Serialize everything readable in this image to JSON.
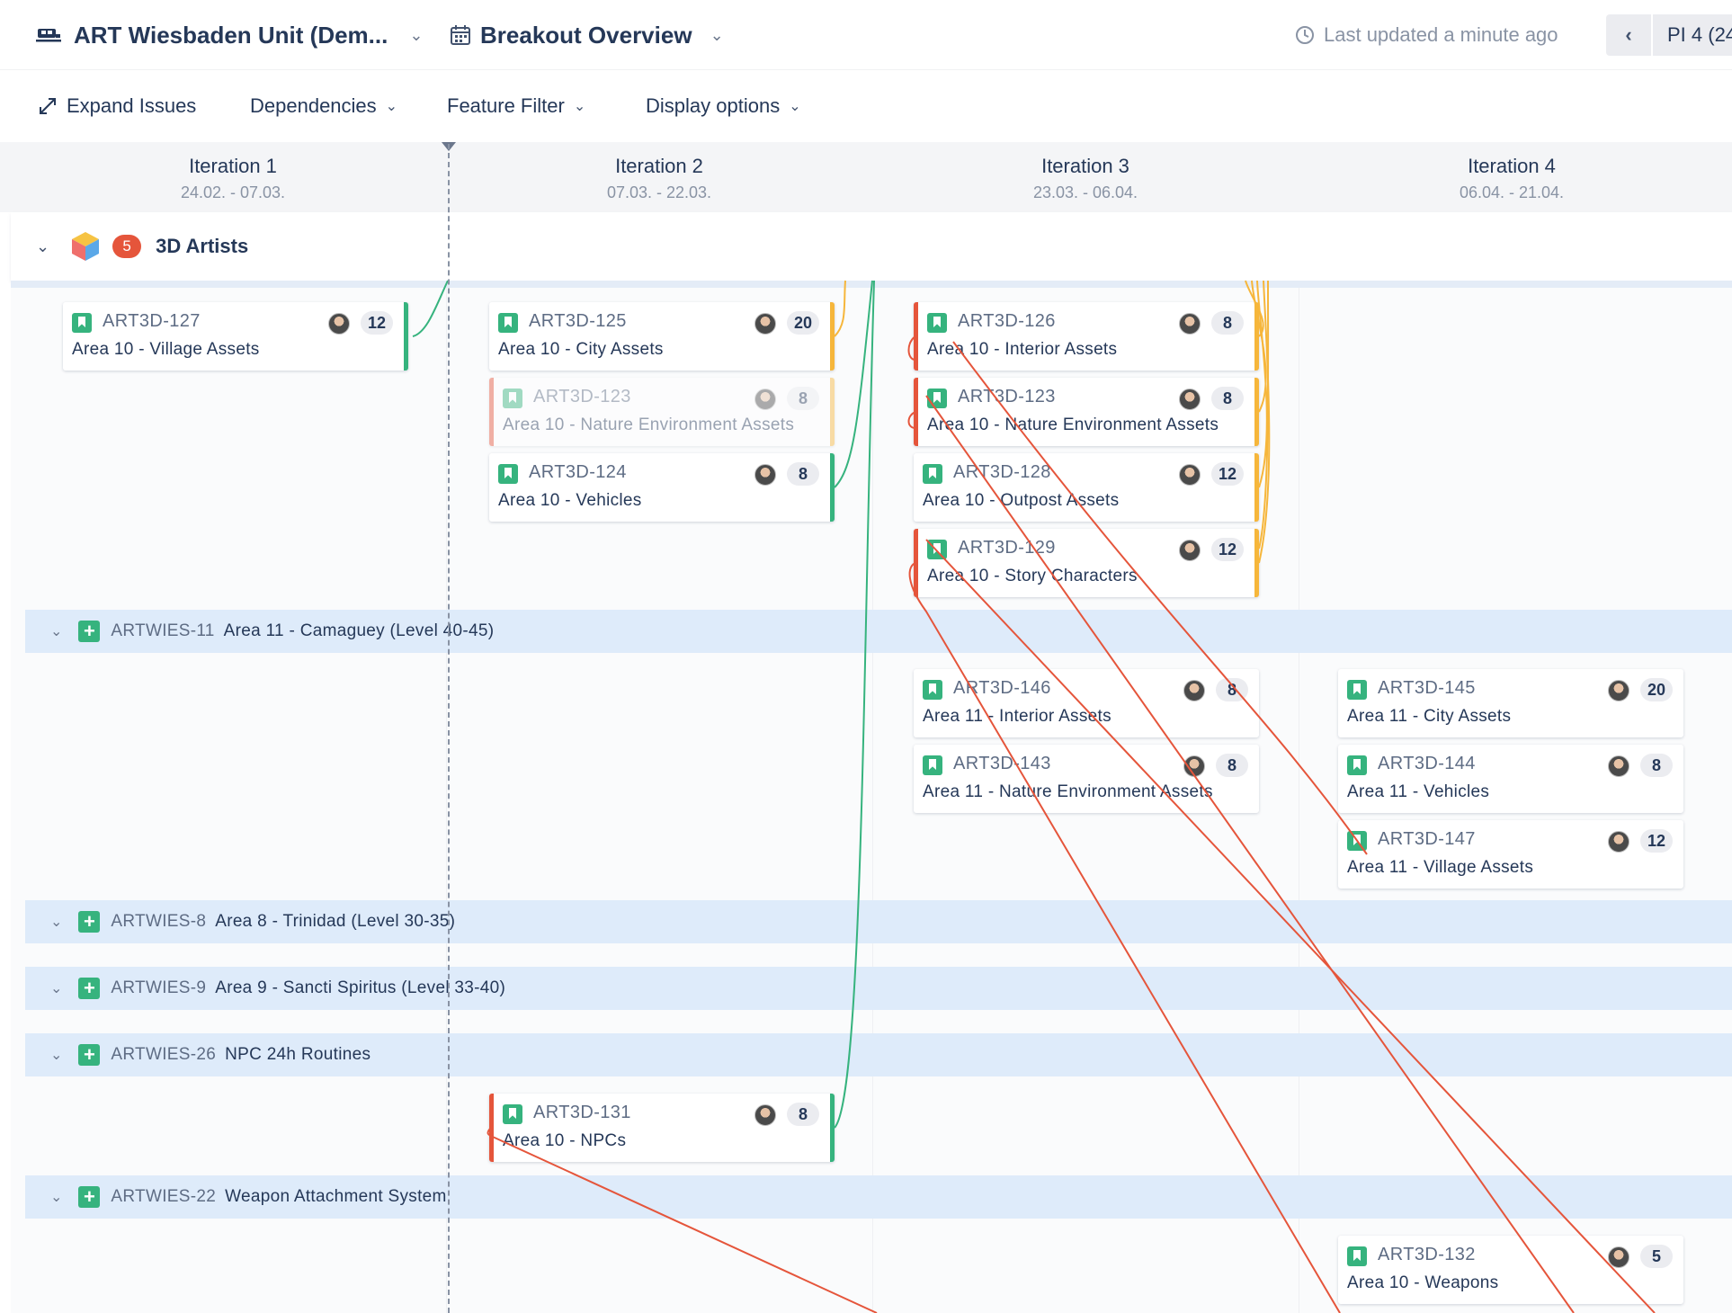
{
  "topbar": {
    "unit_title": "ART Wiesbaden Unit (Dem...",
    "view_title": "Breakout Overview",
    "last_updated": "Last updated a minute ago",
    "pi_label": "PI 4 (24"
  },
  "toolbar": {
    "expand_issues": "Expand Issues",
    "dependencies": "Dependencies",
    "feature_filter": "Feature Filter",
    "display_options": "Display options"
  },
  "iterations": [
    {
      "name": "Iteration 1",
      "dates": "24.02. - 07.03."
    },
    {
      "name": "Iteration 2",
      "dates": "07.03. - 22.03."
    },
    {
      "name": "Iteration 3",
      "dates": "23.03. - 06.04."
    },
    {
      "name": "Iteration 4",
      "dates": "06.04. - 21.04."
    }
  ],
  "team": {
    "name": "3D Artists",
    "badge": "5"
  },
  "features": [
    {
      "key": "ARTWIES-11",
      "summary": "Area 11 - Camaguey (Level 40-45)"
    },
    {
      "key": "ARTWIES-8",
      "summary": "Area 8 - Trinidad (Level 30-35)"
    },
    {
      "key": "ARTWIES-9",
      "summary": "Area 9 - Sancti Spiritus (Level 33-40)"
    },
    {
      "key": "ARTWIES-26",
      "summary": "NPC 24h Routines"
    },
    {
      "key": "ARTWIES-22",
      "summary": "Weapon Attachment System"
    }
  ],
  "cards": [
    {
      "key": "ART3D-127",
      "summary": "Area 10 - Village Assets",
      "points": "12"
    },
    {
      "key": "ART3D-125",
      "summary": "Area 10 - City Assets",
      "points": "20"
    },
    {
      "key": "ART3D-123",
      "summary": "Area 10 - Nature Environment Assets",
      "points": "8"
    },
    {
      "key": "ART3D-124",
      "summary": "Area 10 - Vehicles",
      "points": "8"
    },
    {
      "key": "ART3D-126",
      "summary": "Area 10 - Interior Assets",
      "points": "8"
    },
    {
      "key": "ART3D-123",
      "summary": "Area 10 - Nature Environment Assets",
      "points": "8"
    },
    {
      "key": "ART3D-128",
      "summary": "Area 10 - Outpost Assets",
      "points": "12"
    },
    {
      "key": "ART3D-129",
      "summary": "Area 10 - Story Characters",
      "points": "12"
    },
    {
      "key": "ART3D-146",
      "summary": "Area 11 - Interior Assets",
      "points": "8"
    },
    {
      "key": "ART3D-143",
      "summary": "Area 11 - Nature Environment Assets",
      "points": "8"
    },
    {
      "key": "ART3D-145",
      "summary": "Area 11 - City Assets",
      "points": "20"
    },
    {
      "key": "ART3D-144",
      "summary": "Area 11 - Vehicles",
      "points": "8"
    },
    {
      "key": "ART3D-147",
      "summary": "Area 11 - Village Assets",
      "points": "12"
    },
    {
      "key": "ART3D-131",
      "summary": "Area 10 - NPCs",
      "points": "8"
    },
    {
      "key": "ART3D-132",
      "summary": "Area 10 - Weapons",
      "points": "5"
    }
  ],
  "colors": {
    "dependency_ok": "#36b37e",
    "dependency_warning": "#f6b63b",
    "dependency_conflict": "#e5553b",
    "feature_row": "#deebfa",
    "story_icon": "#36b37e"
  }
}
